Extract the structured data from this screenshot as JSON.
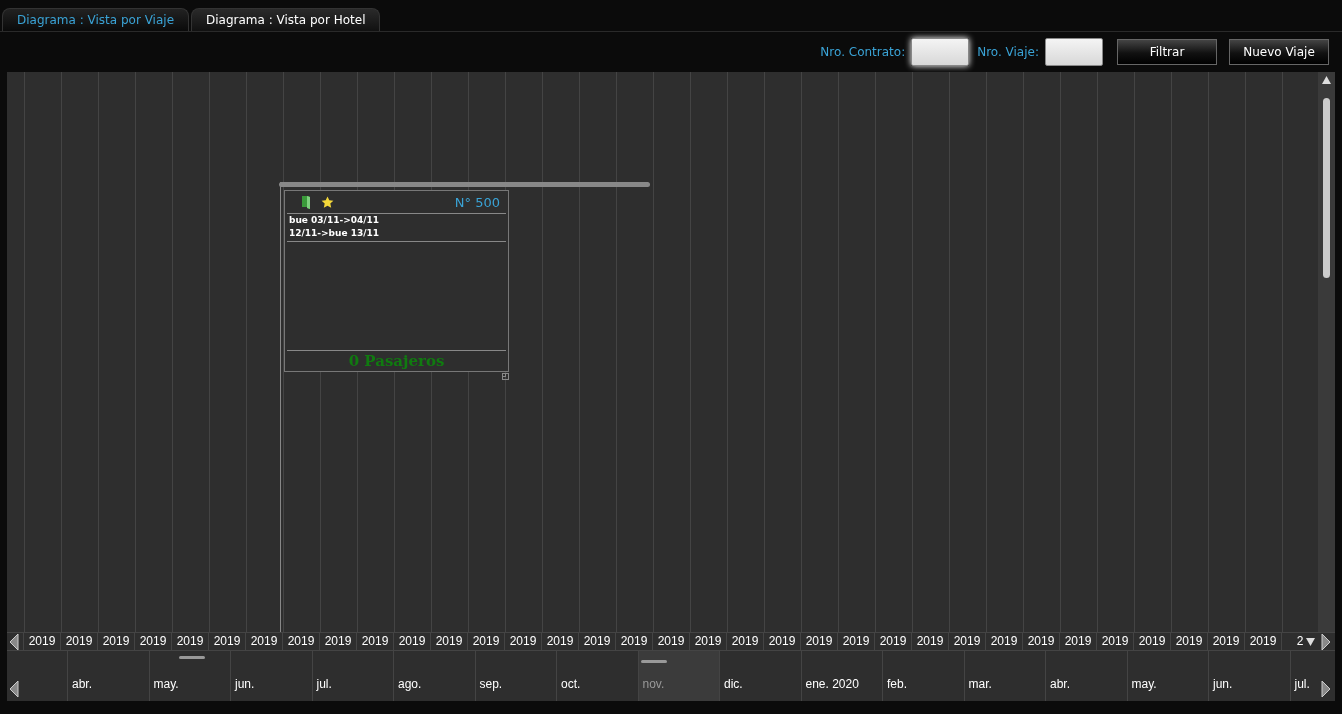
{
  "tabs": [
    {
      "label": "Diagrama : Vista por Viaje",
      "selected": true
    },
    {
      "label": "Diagrama : Vista por Hotel",
      "selected": false
    }
  ],
  "toolbar": {
    "fields": [
      {
        "label": "Nro. Contrato:",
        "focused": true
      },
      {
        "label": "Nro. Viaje:",
        "focused": false
      }
    ],
    "buttons": [
      "Filtrar",
      "Nuevo Viaje"
    ]
  },
  "trip": {
    "number": "N° 500",
    "segments": [
      "bue 03/11->04/11",
      "12/11->bue 13/11"
    ],
    "passengers": "0 Pasajeros"
  },
  "years": [
    "2019",
    "2019",
    "2019",
    "2019",
    "2019",
    "2019",
    "2019",
    "2019",
    "2019",
    "2019",
    "2019",
    "2019",
    "2019",
    "2019",
    "2019",
    "2019",
    "2019",
    "2019",
    "2019",
    "2019",
    "2019",
    "2019",
    "2019",
    "2019",
    "2019",
    "2019",
    "2019",
    "2019",
    "2019",
    "2019",
    "2019",
    "2019",
    "2019",
    "2019",
    "2"
  ],
  "months": [
    {
      "label": "abr.",
      "selected": false
    },
    {
      "label": "may.",
      "selected": false
    },
    {
      "label": "jun.",
      "selected": false
    },
    {
      "label": "jul.",
      "selected": false
    },
    {
      "label": "ago.",
      "selected": false
    },
    {
      "label": "sep.",
      "selected": false
    },
    {
      "label": "oct.",
      "selected": false
    },
    {
      "label": "nov.",
      "selected": true
    },
    {
      "label": "dic.",
      "selected": false
    },
    {
      "label": "ene. 2020",
      "selected": false
    },
    {
      "label": "feb.",
      "selected": false
    },
    {
      "label": "mar.",
      "selected": false
    },
    {
      "label": "abr.",
      "selected": false
    },
    {
      "label": "may.",
      "selected": false
    },
    {
      "label": "jun.",
      "selected": false
    },
    {
      "label": "jul.",
      "selected": false
    }
  ]
}
